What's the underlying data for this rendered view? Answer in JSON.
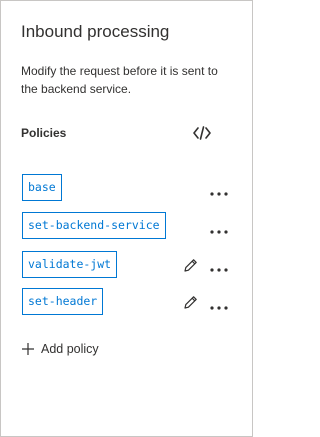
{
  "section": {
    "title": "Inbound processing",
    "description": "Modify the request before it is sent to the backend service."
  },
  "policies": {
    "header": "Policies",
    "code_view_icon": "code-brackets-icon",
    "items": [
      {
        "name": "base",
        "editable": false
      },
      {
        "name": "set-backend-service",
        "editable": false
      },
      {
        "name": "validate-jwt",
        "editable": true
      },
      {
        "name": "set-header",
        "editable": true
      }
    ],
    "more_icon": "more-ellipsis-icon",
    "edit_icon": "pencil-icon"
  },
  "add_policy": {
    "icon": "plus-icon",
    "label": "Add policy"
  },
  "colors": {
    "accent": "#0078d4",
    "text": "#323130",
    "border": "#c8c6c4"
  }
}
